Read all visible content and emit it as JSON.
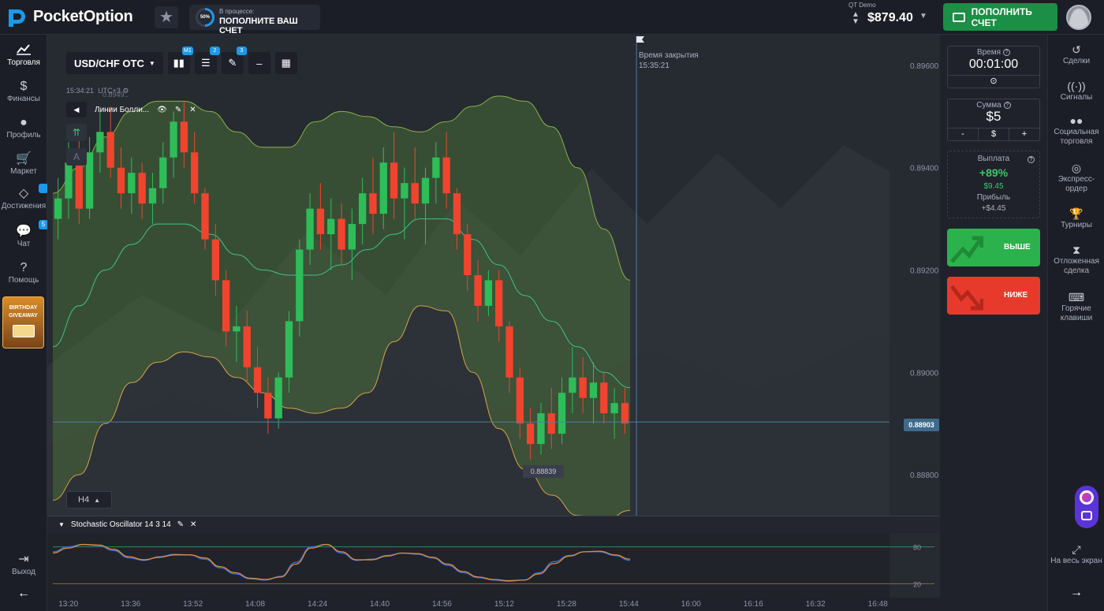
{
  "topbar": {
    "logo_text": "PocketOption",
    "progress_percent": "50%",
    "progress_label": "В процессе:",
    "progress_cta": "ПОПОЛНИТЕ ВАШ СЧЕТ",
    "account_type": "QT Demo",
    "balance": "$879.40",
    "deposit_label": "ПОПОЛНИТЬ СЧЕТ"
  },
  "leftnav": {
    "items": [
      {
        "label": "Торговля",
        "icon": "chart-line-icon"
      },
      {
        "label": "Финансы",
        "icon": "dollar-icon"
      },
      {
        "label": "Профиль",
        "icon": "user-icon"
      },
      {
        "label": "Маркет",
        "icon": "cart-icon"
      },
      {
        "label": "Достижения",
        "icon": "diamond-icon"
      },
      {
        "label": "Чат",
        "icon": "chat-icon"
      },
      {
        "label": "Помощь",
        "icon": "help-icon"
      }
    ],
    "badges": {
      "achievements": "",
      "chat": "5"
    },
    "promo_line1": "BIRTHDAY",
    "promo_line2": "GIVEAWAY",
    "exit_label": "Выход"
  },
  "chart": {
    "pair": "USD/CHF OTC",
    "toolbar_badges": {
      "candles": "M1",
      "settings": "2",
      "draw": "3"
    },
    "server_time": "15:34:21",
    "timezone": "UTC+3",
    "indicator_name": "Линии Болли...",
    "timeframe": "H4",
    "close_label": "Время закрытия",
    "close_time": "15:35:21",
    "current_price": "0.88903",
    "low_price": "0.88839",
    "top_value_faded": "0.8949..",
    "stoch_name": "Stochastic Oscillator 14 3 14",
    "stoch_levels": [
      "80",
      "20"
    ],
    "price_ticks": [
      "0.89600",
      "0.89400",
      "0.89200",
      "0.89000",
      "0.88800"
    ],
    "time_ticks": [
      "13:20",
      "13:36",
      "13:52",
      "14:08",
      "14:24",
      "14:40",
      "14:56",
      "15:12",
      "15:28",
      "15:44",
      "16:00",
      "16:16",
      "16:32",
      "16:48"
    ]
  },
  "trade": {
    "time_label": "Время",
    "time_value": "00:01:00",
    "amount_label": "Сумма",
    "amount_value": "$5",
    "amount_minus": "-",
    "amount_currency": "$",
    "amount_plus": "+",
    "payout_label": "Выплата",
    "payout_percent": "+89%",
    "payout_amount": "$9.45",
    "profit_label": "Прибыль",
    "profit_amount": "+$4.45",
    "higher_label": "ВЫШЕ",
    "lower_label": "НИЖЕ"
  },
  "rightnav": {
    "items": [
      {
        "label": "Сделки",
        "icon": "history-icon"
      },
      {
        "label": "Сигналы",
        "icon": "signal-icon"
      },
      {
        "label": "Социальная торговля",
        "icon": "people-icon"
      },
      {
        "label": "Экспресс-ордер",
        "icon": "target-icon"
      },
      {
        "label": "Турниры",
        "icon": "trophy-icon"
      },
      {
        "label": "Отложенная сделка",
        "icon": "hourglass-icon"
      },
      {
        "label": "Горячие клавиши",
        "icon": "keyboard-icon"
      }
    ],
    "fullscreen_label": "На весь экран"
  },
  "colors": {
    "up": "#2ebd59",
    "down": "#f0442e",
    "accent": "#1b9aeb",
    "deposit": "#1a8f45"
  },
  "chart_data": {
    "type": "candlestick",
    "y_axis_range": [
      0.8872,
      0.8966
    ],
    "x_axis_range": [
      "13:16",
      "16:51"
    ],
    "current_price": 0.88903,
    "series": [
      {
        "name": "Price (OHLC, approx.)",
        "ohlc": [
          [
            0.893,
            0.8938,
            0.8926,
            0.8934
          ],
          [
            0.8934,
            0.8945,
            0.893,
            0.8941
          ],
          [
            0.8941,
            0.8946,
            0.8929,
            0.8932
          ],
          [
            0.8932,
            0.8946,
            0.893,
            0.8943
          ],
          [
            0.8943,
            0.8951,
            0.8939,
            0.8947
          ],
          [
            0.8947,
            0.8952,
            0.8938,
            0.894
          ],
          [
            0.894,
            0.8944,
            0.8932,
            0.8935
          ],
          [
            0.8935,
            0.8942,
            0.8931,
            0.8939
          ],
          [
            0.8939,
            0.8941,
            0.893,
            0.8933
          ],
          [
            0.8933,
            0.8939,
            0.8929,
            0.8936
          ],
          [
            0.8936,
            0.8945,
            0.8933,
            0.8942
          ],
          [
            0.8942,
            0.8951,
            0.8938,
            0.8949
          ],
          [
            0.8949,
            0.8953,
            0.894,
            0.8943
          ],
          [
            0.8943,
            0.8947,
            0.8933,
            0.8935
          ],
          [
            0.8935,
            0.8936,
            0.8924,
            0.8926
          ],
          [
            0.8926,
            0.8929,
            0.8915,
            0.8918
          ],
          [
            0.8918,
            0.892,
            0.8905,
            0.8908
          ],
          [
            0.8908,
            0.8913,
            0.8902,
            0.8909
          ],
          [
            0.8909,
            0.8912,
            0.8898,
            0.8901
          ],
          [
            0.8901,
            0.8905,
            0.8893,
            0.8896
          ],
          [
            0.8896,
            0.8899,
            0.8888,
            0.8891
          ],
          [
            0.8891,
            0.89,
            0.8889,
            0.8899
          ],
          [
            0.8899,
            0.8912,
            0.8896,
            0.891
          ],
          [
            0.891,
            0.8926,
            0.8907,
            0.8924
          ],
          [
            0.8924,
            0.8935,
            0.8921,
            0.8932
          ],
          [
            0.8932,
            0.8937,
            0.8924,
            0.8927
          ],
          [
            0.8927,
            0.8934,
            0.892,
            0.893
          ],
          [
            0.893,
            0.8933,
            0.8921,
            0.8924
          ],
          [
            0.8924,
            0.8932,
            0.8918,
            0.8929
          ],
          [
            0.8929,
            0.8938,
            0.8925,
            0.8935
          ],
          [
            0.8935,
            0.8942,
            0.8927,
            0.8931
          ],
          [
            0.8931,
            0.8944,
            0.8928,
            0.8941
          ],
          [
            0.8941,
            0.8947,
            0.893,
            0.8934
          ],
          [
            0.8934,
            0.894,
            0.8926,
            0.8937
          ],
          [
            0.8937,
            0.8944,
            0.893,
            0.8933
          ],
          [
            0.8933,
            0.894,
            0.8925,
            0.8938
          ],
          [
            0.8938,
            0.8945,
            0.8933,
            0.8942
          ],
          [
            0.8942,
            0.8947,
            0.8932,
            0.8935
          ],
          [
            0.8935,
            0.8936,
            0.8924,
            0.8927
          ],
          [
            0.8927,
            0.8929,
            0.8916,
            0.8919
          ],
          [
            0.8919,
            0.8922,
            0.891,
            0.8913
          ],
          [
            0.8913,
            0.892,
            0.8911,
            0.8918
          ],
          [
            0.8918,
            0.892,
            0.8906,
            0.8909
          ],
          [
            0.8909,
            0.891,
            0.8896,
            0.8899
          ],
          [
            0.8899,
            0.8901,
            0.8887,
            0.889
          ],
          [
            0.889,
            0.8893,
            0.8883,
            0.8886
          ],
          [
            0.8886,
            0.8894,
            0.8884,
            0.8892
          ],
          [
            0.8892,
            0.8897,
            0.8885,
            0.8888
          ],
          [
            0.8888,
            0.8899,
            0.8886,
            0.8896
          ],
          [
            0.8896,
            0.8905,
            0.8892,
            0.8899
          ],
          [
            0.8899,
            0.8903,
            0.8892,
            0.8895
          ],
          [
            0.8895,
            0.8902,
            0.889,
            0.8898
          ],
          [
            0.8898,
            0.89,
            0.889,
            0.8892
          ],
          [
            0.8892,
            0.8897,
            0.8887,
            0.8894
          ],
          [
            0.8894,
            0.8897,
            0.8888,
            0.889
          ]
        ]
      },
      {
        "name": "Bollinger upper",
        "values": [
          0.8935,
          0.894,
          0.8946,
          0.8951,
          0.8953,
          0.8953,
          0.8951,
          0.8947,
          0.8944,
          0.8944,
          0.8949,
          0.8951,
          0.895,
          0.8948,
          0.8947,
          0.8949,
          0.8952,
          0.8954,
          0.8953,
          0.8948,
          0.894,
          0.8928,
          0.8918
        ]
      },
      {
        "name": "Bollinger middle",
        "values": [
          0.8905,
          0.8913,
          0.892,
          0.8925,
          0.8929,
          0.8929,
          0.8927,
          0.8923,
          0.892,
          0.8919,
          0.8919,
          0.8921,
          0.8924,
          0.8927,
          0.893,
          0.893,
          0.8926,
          0.8921,
          0.8915,
          0.891,
          0.8905,
          0.89,
          0.8897
        ]
      },
      {
        "name": "Bollinger lower",
        "values": [
          0.8875,
          0.888,
          0.889,
          0.8898,
          0.8902,
          0.8904,
          0.8903,
          0.8899,
          0.8896,
          0.8893,
          0.8892,
          0.8893,
          0.8896,
          0.8906,
          0.8913,
          0.8912,
          0.89,
          0.8889,
          0.8881,
          0.8876,
          0.8872,
          0.8871,
          0.8873
        ]
      },
      {
        "name": "Stochastic %K",
        "values": [
          72,
          80,
          84,
          82,
          74,
          62,
          58,
          64,
          68,
          67,
          60,
          46,
          36,
          28,
          26,
          32,
          55,
          80,
          84,
          70,
          58,
          60,
          66,
          70,
          68,
          62,
          50,
          38,
          30,
          26,
          24,
          26,
          38,
          56,
          66,
          72,
          72,
          66,
          58
        ]
      },
      {
        "name": "Stochastic %D",
        "values": [
          70,
          78,
          84,
          83,
          76,
          64,
          59,
          63,
          67,
          67,
          62,
          48,
          38,
          29,
          27,
          31,
          52,
          78,
          84,
          72,
          59,
          59,
          65,
          70,
          69,
          63,
          52,
          40,
          31,
          27,
          25,
          26,
          36,
          53,
          65,
          72,
          73,
          67,
          60
        ]
      }
    ]
  }
}
